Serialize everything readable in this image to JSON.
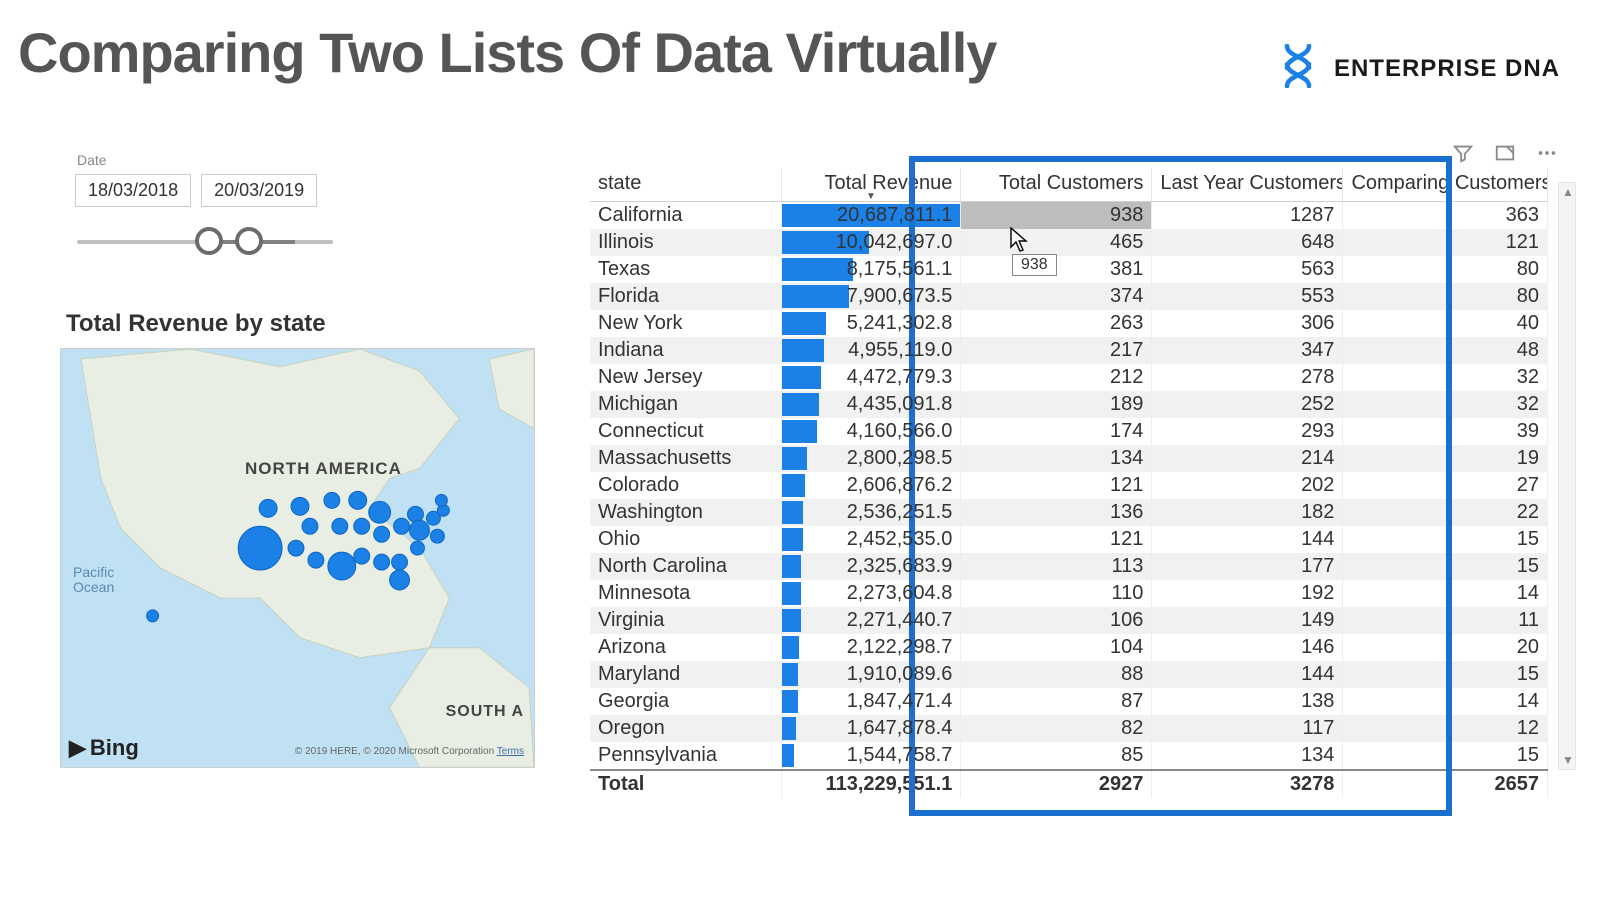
{
  "title": "Comparing Two Lists Of Data Virtually",
  "brand": "ENTERPRISE DNA",
  "date_slicer": {
    "label": "Date",
    "from": "18/03/2018",
    "to": "20/03/2019"
  },
  "map": {
    "title": "Total Revenue by state",
    "provider": "Bing",
    "labels": {
      "na": "NORTH AMERICA",
      "sa": "SOUTH A",
      "pacific1": "Pacific",
      "pacific2": "Ocean"
    },
    "copyright": "© 2019 HERE, © 2020 Microsoft Corporation",
    "terms": "Terms"
  },
  "table": {
    "columns": [
      "state",
      "Total Revenue",
      "Total Customers",
      "Last Year Customers",
      "Comparing Customers"
    ],
    "rows": [
      {
        "state": "California",
        "rev": "20,687,811.1",
        "revBar": 1.0,
        "tc": "938",
        "ly": "1287",
        "cmp": "363"
      },
      {
        "state": "Illinois",
        "rev": "10,042,697.0",
        "revBar": 0.49,
        "tc": "465",
        "ly": "648",
        "cmp": "121"
      },
      {
        "state": "Texas",
        "rev": "8,175,561.1",
        "revBar": 0.4,
        "tc": "381",
        "ly": "563",
        "cmp": "80"
      },
      {
        "state": "Florida",
        "rev": "7,900,673.5",
        "revBar": 0.38,
        "tc": "374",
        "ly": "553",
        "cmp": "80"
      },
      {
        "state": "New York",
        "rev": "5,241,302.8",
        "revBar": 0.25,
        "tc": "263",
        "ly": "306",
        "cmp": "40"
      },
      {
        "state": "Indiana",
        "rev": "4,955,119.0",
        "revBar": 0.24,
        "tc": "217",
        "ly": "347",
        "cmp": "48"
      },
      {
        "state": "New Jersey",
        "rev": "4,472,779.3",
        "revBar": 0.22,
        "tc": "212",
        "ly": "278",
        "cmp": "32"
      },
      {
        "state": "Michigan",
        "rev": "4,435,091.8",
        "revBar": 0.21,
        "tc": "189",
        "ly": "252",
        "cmp": "32"
      },
      {
        "state": "Connecticut",
        "rev": "4,160,566.0",
        "revBar": 0.2,
        "tc": "174",
        "ly": "293",
        "cmp": "39"
      },
      {
        "state": "Massachusetts",
        "rev": "2,800,298.5",
        "revBar": 0.14,
        "tc": "134",
        "ly": "214",
        "cmp": "19"
      },
      {
        "state": "Colorado",
        "rev": "2,606,876.2",
        "revBar": 0.13,
        "tc": "121",
        "ly": "202",
        "cmp": "27"
      },
      {
        "state": "Washington",
        "rev": "2,536,251.5",
        "revBar": 0.12,
        "tc": "136",
        "ly": "182",
        "cmp": "22"
      },
      {
        "state": "Ohio",
        "rev": "2,452,535.0",
        "revBar": 0.12,
        "tc": "121",
        "ly": "144",
        "cmp": "15"
      },
      {
        "state": "North Carolina",
        "rev": "2,325,683.9",
        "revBar": 0.11,
        "tc": "113",
        "ly": "177",
        "cmp": "15"
      },
      {
        "state": "Minnesota",
        "rev": "2,273,604.8",
        "revBar": 0.11,
        "tc": "110",
        "ly": "192",
        "cmp": "14"
      },
      {
        "state": "Virginia",
        "rev": "2,271,440.7",
        "revBar": 0.11,
        "tc": "106",
        "ly": "149",
        "cmp": "11"
      },
      {
        "state": "Arizona",
        "rev": "2,122,298.7",
        "revBar": 0.1,
        "tc": "104",
        "ly": "146",
        "cmp": "20"
      },
      {
        "state": "Maryland",
        "rev": "1,910,089.6",
        "revBar": 0.09,
        "tc": "88",
        "ly": "144",
        "cmp": "15"
      },
      {
        "state": "Georgia",
        "rev": "1,847,471.4",
        "revBar": 0.09,
        "tc": "87",
        "ly": "138",
        "cmp": "14"
      },
      {
        "state": "Oregon",
        "rev": "1,647,878.4",
        "revBar": 0.08,
        "tc": "82",
        "ly": "117",
        "cmp": "12"
      },
      {
        "state": "Pennsylvania",
        "rev": "1,544,758.7",
        "revBar": 0.07,
        "tc": "85",
        "ly": "134",
        "cmp": "15"
      }
    ],
    "total": {
      "label": "Total",
      "rev": "113,229,551.1",
      "tc": "2927",
      "ly": "3278",
      "cmp": "2657"
    }
  },
  "tooltip": "938"
}
